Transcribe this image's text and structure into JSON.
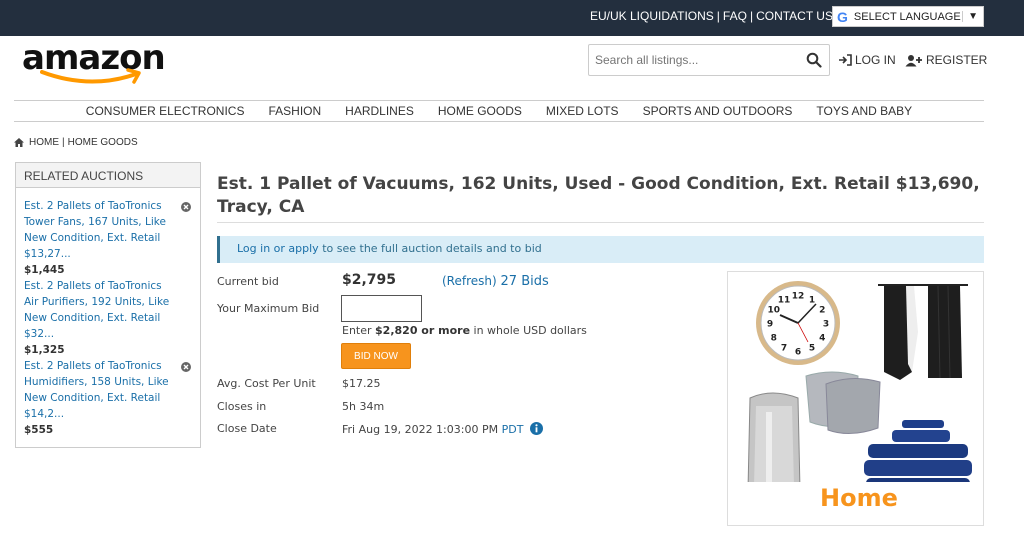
{
  "topbar": {
    "links": [
      "EU/UK LIQUIDATIONS",
      "FAQ",
      "CONTACT US"
    ],
    "language_label": "SELECT LANGUAGE"
  },
  "logo": {
    "text": "amazon"
  },
  "search": {
    "placeholder": "Search all listings..."
  },
  "auth": {
    "login": "LOG IN",
    "register": "REGISTER"
  },
  "categories": [
    "CONSUMER ELECTRONICS",
    "FASHION",
    "HARDLINES",
    "HOME GOODS",
    "MIXED LOTS",
    "SPORTS AND OUTDOORS",
    "TOYS AND BABY"
  ],
  "breadcrumb": {
    "home": "HOME",
    "current": "HOME GOODS"
  },
  "related": {
    "heading": "RELATED AUCTIONS",
    "items": [
      {
        "title": "Est. 2 Pallets of TaoTronics Tower Fans, 167 Units, Like New Condition, Ext. Retail $13,27...",
        "price": "$1,445"
      },
      {
        "title": "Est. 2 Pallets of TaoTronics Air Purifiers, 192 Units, Like New Condition, Ext. Retail $32...",
        "price": "$1,325"
      },
      {
        "title": "Est. 2 Pallets of TaoTronics Humidifiers, 158 Units, Like New Condition, Ext. Retail $14,2...",
        "price": "$555"
      }
    ]
  },
  "auction": {
    "title": "Est. 1 Pallet of Vacuums, 162 Units, Used - Good Condition, Ext. Retail $13,690, Tracy, CA",
    "notice_link": "Log in or apply",
    "notice_text": "to see the full auction details and to bid",
    "current_bid_label": "Current bid",
    "current_bid": "$2,795",
    "refresh": "(Refresh)",
    "bids": "27 Bids",
    "max_bid_label": "Your Maximum Bid",
    "enter_prefix": "Enter",
    "enter_amount": "$2,820 or more",
    "enter_suffix": "in whole USD dollars",
    "bid_now": "BID NOW",
    "avg_cost_label": "Avg. Cost Per Unit",
    "avg_cost": "$17.25",
    "closes_in_label": "Closes in",
    "closes_in": "5h 34m",
    "close_date_label": "Close Date",
    "close_date": "Fri Aug 19, 2022 1:03:00 PM",
    "timezone": "PDT"
  },
  "photo": {
    "caption": "Home",
    "clock_numbers": [
      "12",
      "1",
      "2",
      "3",
      "4",
      "5",
      "6",
      "7",
      "8",
      "9",
      "10",
      "11"
    ]
  },
  "colors": {
    "topbar": "#232f3e",
    "accent": "#f7941d",
    "link": "#1a6fa8",
    "notice_bg": "#d9edf7"
  }
}
